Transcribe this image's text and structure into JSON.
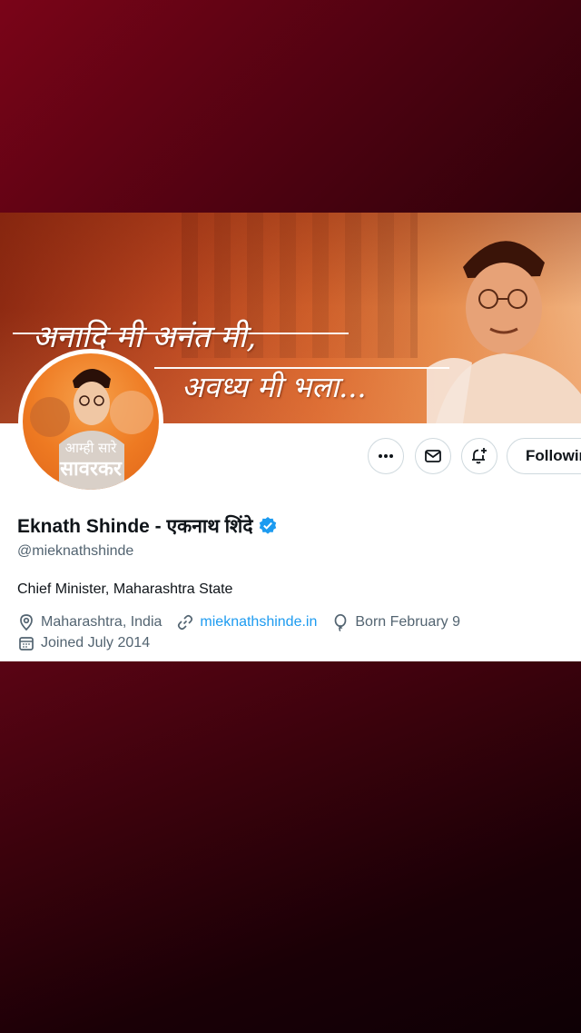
{
  "banner": {
    "line1": "अनादि मी अनंत मी,",
    "line2": "अवध्य मी भला..."
  },
  "avatar": {
    "line1": "आम्ही सारे",
    "line2": "सावरकर"
  },
  "actions": {
    "more_icon": "more-icon",
    "message_icon": "mail-icon",
    "notify_icon": "bell-plus-icon",
    "follow_label": "Following"
  },
  "profile": {
    "name": "Eknath Shinde - एकनाथ शिंदे",
    "verified": true,
    "handle": "@mieknathshinde",
    "bio": "Chief Minister, Maharashtra State",
    "location": "Maharashtra, India",
    "website": "mieknathshinde.in",
    "birthday": "Born February 9",
    "joined": "Joined July 2014"
  },
  "colors": {
    "link": "#1d9bf0",
    "verified": "#1d9bf0",
    "secondary_text": "#536471",
    "primary_text": "#0f1419"
  }
}
